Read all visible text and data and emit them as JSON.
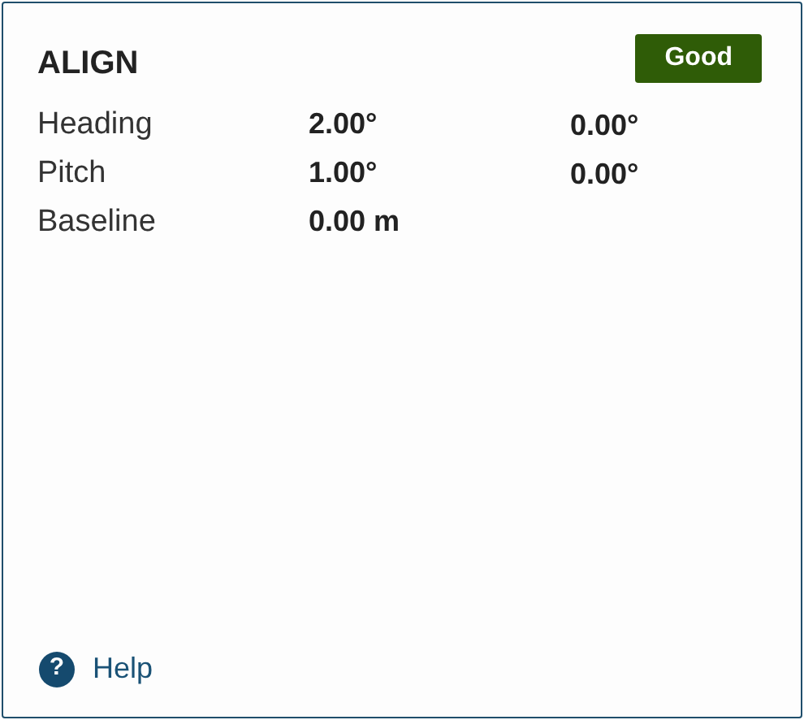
{
  "title": "ALIGN",
  "status": {
    "label": "Good",
    "kind": "good"
  },
  "rows": [
    {
      "label": "Heading",
      "value_1": "2.00°",
      "value_2": "0.00°"
    },
    {
      "label": "Pitch",
      "value_1": "1.00°",
      "value_2": "0.00°"
    },
    {
      "label": "Baseline",
      "value_1": "0.00 m"
    }
  ],
  "help_icon": "?",
  "help_link": "Help"
}
